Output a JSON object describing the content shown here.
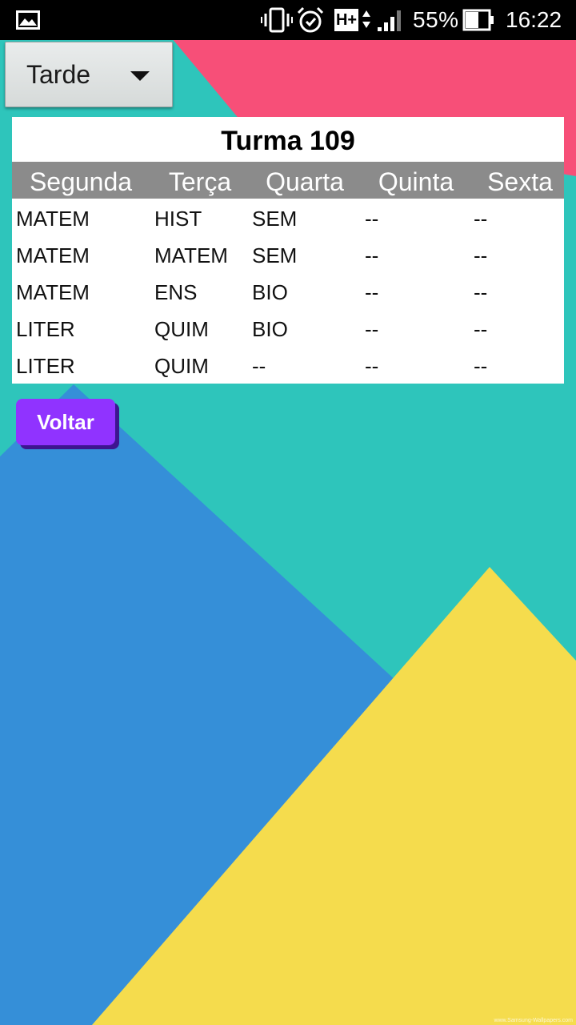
{
  "status_bar": {
    "battery_percent": "55%",
    "time": "16:22",
    "network_type": "H+",
    "icons": [
      "gallery-icon",
      "vibrate-icon",
      "alarm-icon",
      "network-hplus-icon",
      "signal-icon",
      "battery-icon"
    ]
  },
  "spinner": {
    "selected": "Tarde"
  },
  "schedule": {
    "title": "Turma 109",
    "headers": [
      "Segunda",
      "Terça",
      "Quarta",
      "Quinta",
      "Sexta"
    ],
    "rows": [
      [
        "MATEM",
        "HIST",
        "SEM",
        "--",
        "--"
      ],
      [
        "MATEM",
        "MATEM",
        "SEM",
        "--",
        "--"
      ],
      [
        "MATEM",
        "ENS",
        "BIO",
        "--",
        "--"
      ],
      [
        "LITER",
        "QUIM",
        "BIO",
        "--",
        "--"
      ],
      [
        "LITER",
        "QUIM",
        "--",
        "--",
        "--"
      ]
    ]
  },
  "back_button": {
    "label": "Voltar"
  },
  "wallpaper": {
    "watermark": "www.Samsung-Wallpapers.com"
  },
  "colors": {
    "teal": "#2ec5bb",
    "pink": "#f74f78",
    "blue": "#358fd8",
    "yellow": "#f5dc4d",
    "button": "#9033ff",
    "header_row": "#8b8b8b"
  }
}
